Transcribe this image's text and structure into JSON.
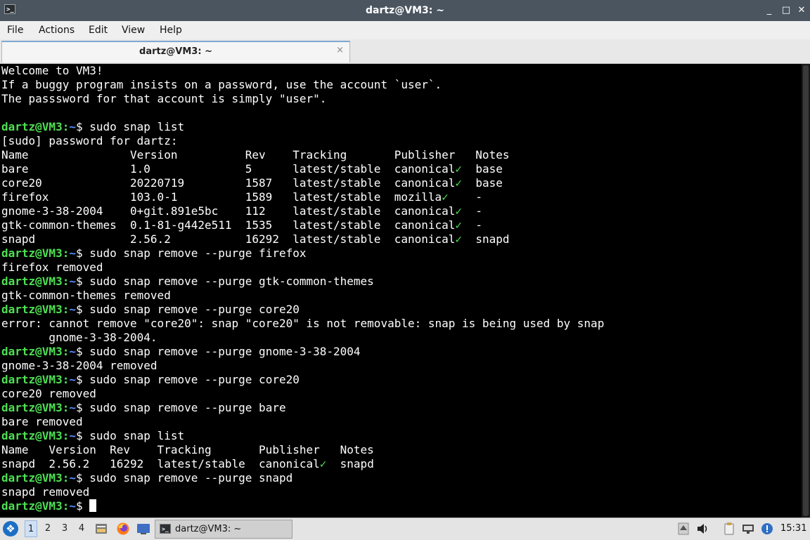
{
  "window": {
    "title": "dartz@VM3: ~",
    "minimize_glyph": "_",
    "maximize_glyph": "□",
    "close_glyph": "✕"
  },
  "menu": [
    "File",
    "Actions",
    "Edit",
    "View",
    "Help"
  ],
  "tab": {
    "label": "dartz@VM3: ~",
    "close_glyph": "×"
  },
  "prompt": {
    "user_host": "dartz@VM3",
    "colon": ":",
    "path": "~",
    "symbol": "$ "
  },
  "terminal_lines": [
    {
      "text": "Welcome to VM3!"
    },
    {
      "text": "If a buggy program insists on a password, use the account `user`."
    },
    {
      "text": "The passsword for that account is simply \"user\"."
    },
    {
      "text": ""
    },
    {
      "prompt": true,
      "text": "sudo snap list"
    },
    {
      "text": "[sudo] password for dartz:"
    },
    {
      "text": "Name               Version          Rev    Tracking       Publisher   Notes"
    },
    {
      "text": "bare               1.0              5      latest/stable  canonical",
      "check": true,
      "rest": "  base"
    },
    {
      "text": "core20             20220719         1587   latest/stable  canonical",
      "check": true,
      "rest": "  base"
    },
    {
      "text": "firefox            103.0-1          1589   latest/stable  mozilla",
      "check": true,
      "rest": "    -"
    },
    {
      "text": "gnome-3-38-2004    0+git.891e5bc    112    latest/stable  canonical",
      "check": true,
      "rest": "  -"
    },
    {
      "text": "gtk-common-themes  0.1-81-g442e511  1535   latest/stable  canonical",
      "check": true,
      "rest": "  -"
    },
    {
      "text": "snapd              2.56.2           16292  latest/stable  canonical",
      "check": true,
      "rest": "  snapd"
    },
    {
      "prompt": true,
      "text": "sudo snap remove --purge firefox"
    },
    {
      "text": "firefox removed"
    },
    {
      "prompt": true,
      "text": "sudo snap remove --purge gtk-common-themes"
    },
    {
      "text": "gtk-common-themes removed"
    },
    {
      "prompt": true,
      "text": "sudo snap remove --purge core20"
    },
    {
      "text": "error: cannot remove \"core20\": snap \"core20\" is not removable: snap is being used by snap"
    },
    {
      "text": "       gnome-3-38-2004."
    },
    {
      "prompt": true,
      "text": "sudo snap remove --purge gnome-3-38-2004"
    },
    {
      "text": "gnome-3-38-2004 removed"
    },
    {
      "prompt": true,
      "text": "sudo snap remove --purge core20"
    },
    {
      "text": "core20 removed"
    },
    {
      "prompt": true,
      "text": "sudo snap remove --purge bare"
    },
    {
      "text": "bare removed"
    },
    {
      "prompt": true,
      "text": "sudo snap list"
    },
    {
      "text": "Name   Version  Rev    Tracking       Publisher   Notes"
    },
    {
      "text": "snapd  2.56.2   16292  latest/stable  canonical",
      "check": true,
      "rest": "  snapd"
    },
    {
      "prompt": true,
      "text": "sudo snap remove --purge snapd"
    },
    {
      "text": "snapd removed"
    },
    {
      "prompt": true,
      "text": "",
      "cursor": true
    }
  ],
  "check_glyph": "✓",
  "taskbar": {
    "workspaces": [
      "1",
      "2",
      "3",
      "4"
    ],
    "active_workspace": "1",
    "task_label": "dartz@VM3: ~",
    "clock": "15:31",
    "icons": [
      "start-menu-icon",
      "file-manager-icon",
      "firefox-icon",
      "desktop-icon",
      "terminal-icon",
      "up-arrow-icon",
      "volume-icon",
      "clipboard-icon",
      "network-icon",
      "notification-icon"
    ]
  },
  "colors": {
    "titlebar": "#4b5560",
    "prompt_user": "#4fe054",
    "prompt_path": "#5c8dff",
    "terminal_bg": "#000000"
  }
}
